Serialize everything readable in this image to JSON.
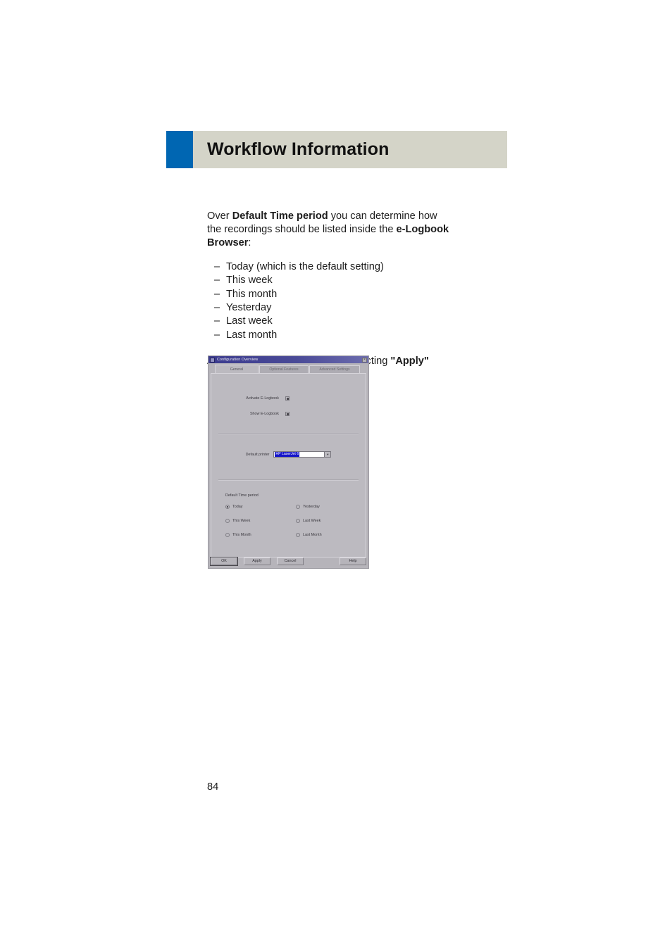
{
  "header": {
    "title": "Workflow Information",
    "accent_color": "#0066b2",
    "band_color": "#d4d4c8"
  },
  "content": {
    "intro_prefix": "Over ",
    "intro_bold_1": "Default Time period",
    "intro_middle": " you can determine how the recordings should be listed inside the ",
    "intro_bold_2": "e-Logbook Browser",
    "intro_suffix": ":",
    "bullets": [
      "Today (which is the default setting)",
      "This week",
      "This month",
      "Yesterday",
      "Last week",
      "Last month"
    ],
    "bullet_dash": "–",
    "closing_prefix": "Any changes can be saved by selecting ",
    "closing_bold": "\"Apply\""
  },
  "dialog": {
    "title": "Configuration Overview",
    "sysmenu_icon": "window-icon",
    "close_icon": "×",
    "tabs": [
      {
        "label": "General",
        "active": true
      },
      {
        "label": "Optional Features",
        "active": false
      },
      {
        "label": "Advanced Settings",
        "active": false
      }
    ],
    "checkboxes": [
      {
        "label": "Activate E-Logbook",
        "checked": true
      },
      {
        "label": "Show E-Logbook",
        "checked": true
      }
    ],
    "printer": {
      "label": "Default printer",
      "value": "HP LaserJet 6",
      "arrow_icon": "chevron-down-icon"
    },
    "time_period": {
      "group_label": "Default Time period",
      "options": [
        {
          "label": "Today",
          "selected": true
        },
        {
          "label": "Yesterday",
          "selected": false
        },
        {
          "label": "This Week",
          "selected": false
        },
        {
          "label": "Last Week",
          "selected": false
        },
        {
          "label": "This Month",
          "selected": false
        },
        {
          "label": "Last Month",
          "selected": false
        }
      ]
    },
    "buttons": {
      "ok": "OK",
      "apply": "Apply",
      "cancel": "Cancel",
      "help": "Help"
    }
  },
  "footer": {
    "page_number": "84"
  }
}
